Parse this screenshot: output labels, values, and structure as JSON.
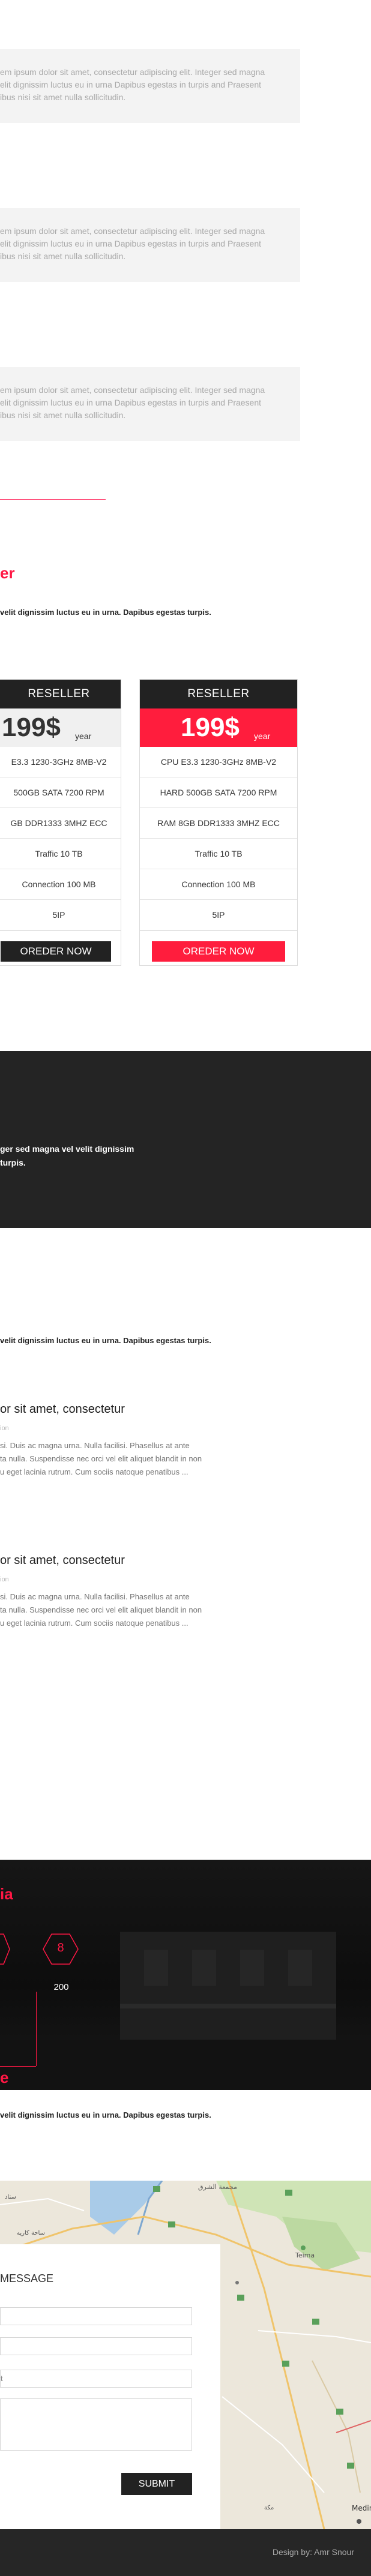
{
  "quotes": [
    {
      "lines": [
        "em ipsum dolor sit amet, consectetur adipiscing elit. Integer sed magna",
        "elit dignissim luctus eu in urna Dapibus egestas in turpis and Praesent",
        "ibus nisi sit amet nulla sollicitudin."
      ]
    },
    {
      "lines": [
        "em ipsum dolor sit amet, consectetur adipiscing elit. Integer sed magna",
        "elit dignissim luctus eu in urna Dapibus egestas in turpis and Praesent",
        "ibus nisi sit amet nulla sollicitudin."
      ]
    },
    {
      "lines": [
        "em ipsum dolor sit amet, consectetur adipiscing elit. Integer sed magna",
        "elit dignissim luctus eu in urna Dapibus egestas in turpis and Praesent",
        "ibus nisi sit amet nulla sollicitudin."
      ]
    }
  ],
  "pricing": {
    "heading": "er",
    "lead": "velit dignissim luctus eu in urna. Dapibus egestas turpis.",
    "cards": [
      {
        "title": "RESELLER",
        "price": "199$",
        "period": "year",
        "features": [
          "E3.3 1230-3GHz 8MB-V2",
          "500GB SATA 7200 RPM",
          "GB DDR1333 3MHZ ECC",
          "Traffic 10 TB",
          "Connection 100 MB",
          "5IP"
        ],
        "button": "OREDER NOW",
        "accent": "#222222"
      },
      {
        "title": "RESELLER",
        "price": "199$",
        "period": "year",
        "features": [
          "CPU E3.3 1230-3GHz 8MB-V2",
          "HARD 500GB SATA 7200 RPM",
          "RAM 8GB DDR1333 3MHZ ECC",
          "Traffic 10 TB",
          "Connection 100 MB",
          "5IP"
        ],
        "button": "OREDER NOW",
        "accent": "#ff1d3d"
      }
    ]
  },
  "dark_band": {
    "lines": [
      "ger sed magna vel velit dignissim",
      "turpis."
    ]
  },
  "blog": {
    "lead": "velit dignissim luctus eu in urna. Dapibus egestas turpis.",
    "posts": [
      {
        "title": "or sit amet, consectetur",
        "meta": "ion",
        "lines": [
          "si. Duis ac magna urna. Nulla facilisi. Phasellus at ante",
          "ta nulla. Suspendisse nec orci vel elit aliquet blandit in non",
          "u eget lacinia rutrum. Cum sociis natoque penatibus ..."
        ]
      },
      {
        "title": "or sit amet, consectetur",
        "meta": "ion",
        "lines": [
          "si. Duis ac magna urna. Nulla facilisi. Phasellus at ante",
          "ta nulla. Suspendisse nec orci vel elit aliquet blandit in non",
          "u eget lacinia rutrum. Cum sociis natoque penatibus ..."
        ]
      }
    ]
  },
  "stats": {
    "heading": "ia",
    "hex_value": "8",
    "counter": "200"
  },
  "contact": {
    "heading": "e",
    "lead": "velit dignissim luctus eu in urna. Dapibus egestas turpis.",
    "form_title": "MESSAGE",
    "subject_placeholder": "t",
    "submit": "SUBMIT"
  },
  "map": {
    "labels": [
      "مجمعة الشرق",
      "ساحة كاريه",
      "ستاد",
      "Teima",
      "Medin",
      "مكة"
    ]
  },
  "footer": {
    "credit": "Design by: Amr Snour"
  },
  "colors": {
    "accent": "#ff1744",
    "dark": "#222222"
  }
}
